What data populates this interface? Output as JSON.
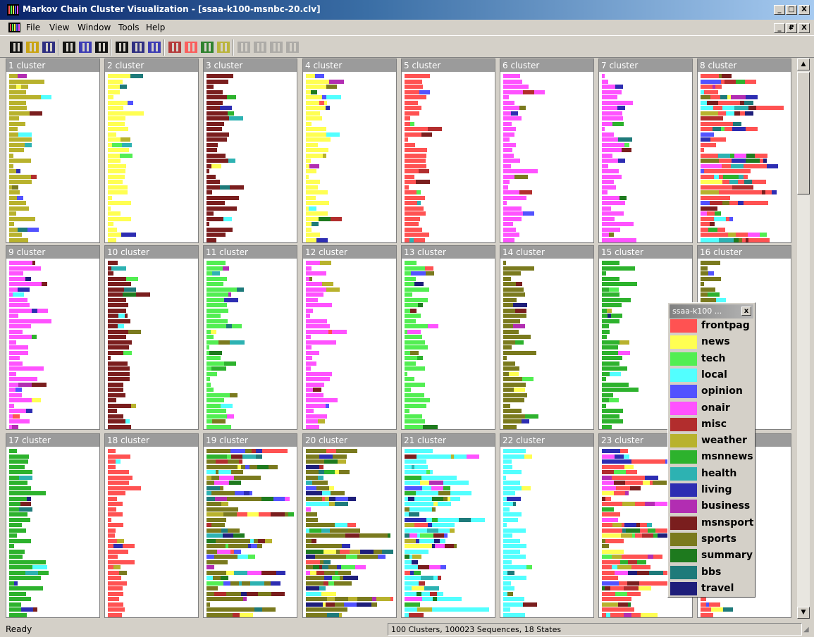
{
  "window": {
    "title": "Markov Chain Cluster Visualization - [ssaa-k100-msnbc-20.clv]"
  },
  "caption_buttons": [
    "_",
    "□",
    "X"
  ],
  "mdi_buttons": [
    "_",
    "₽",
    "X"
  ],
  "menu": [
    "File",
    "View",
    "Window",
    "Tools",
    "Help"
  ],
  "toolbar": [
    {
      "name": "new-file-icon"
    },
    {
      "name": "open-folder-icon"
    },
    {
      "name": "save-disk-icon"
    },
    {
      "sep": true
    },
    {
      "name": "layout-bars-icon"
    },
    {
      "name": "pattern-grid-icon"
    },
    {
      "name": "stacked-rows-icon"
    },
    {
      "sep": true
    },
    {
      "name": "columns-icon"
    },
    {
      "name": "grid-view-icon"
    },
    {
      "name": "sort-down-icon"
    },
    {
      "sep": true
    },
    {
      "name": "sort-numeric-icon"
    },
    {
      "name": "scatter-icon"
    },
    {
      "name": "tree-icon"
    },
    {
      "name": "expand-icon"
    },
    {
      "sep": true
    },
    {
      "name": "ab-icon"
    },
    {
      "name": "ab-comma-icon"
    },
    {
      "name": "star-burst-icon"
    },
    {
      "name": "star-burst-2-icon"
    }
  ],
  "legend": {
    "title": "ssaa-k100 ...",
    "close": "x",
    "items": [
      {
        "label": "frontpag",
        "color": "#ff5252"
      },
      {
        "label": "news",
        "color": "#ffff52"
      },
      {
        "label": "tech",
        "color": "#52ee52"
      },
      {
        "label": "local",
        "color": "#52ffff"
      },
      {
        "label": "opinion",
        "color": "#5252ff"
      },
      {
        "label": "onair",
        "color": "#ff52ff"
      },
      {
        "label": "misc",
        "color": "#b22d2d"
      },
      {
        "label": "weather",
        "color": "#b8b22d"
      },
      {
        "label": "msnnews",
        "color": "#2db22d"
      },
      {
        "label": "health",
        "color": "#2db2b2"
      },
      {
        "label": "living",
        "color": "#2d2db2"
      },
      {
        "label": "business",
        "color": "#b22db2"
      },
      {
        "label": "msnsport",
        "color": "#7a1e1e"
      },
      {
        "label": "sports",
        "color": "#7a7a1e"
      },
      {
        "label": "summary",
        "color": "#1e7a1e"
      },
      {
        "label": "bbs",
        "color": "#1e7a7a"
      },
      {
        "label": "travel",
        "color": "#1e1e7a"
      }
    ]
  },
  "clusters": [
    {
      "title": "1 cluster",
      "dominant": 7
    },
    {
      "title": "2 cluster",
      "dominant": 1
    },
    {
      "title": "3 cluster",
      "dominant": 12
    },
    {
      "title": "4 cluster",
      "dominant": 1
    },
    {
      "title": "5 cluster",
      "dominant": 0
    },
    {
      "title": "6 cluster",
      "dominant": 5
    },
    {
      "title": "7 cluster",
      "dominant": 5
    },
    {
      "title": "8 cluster",
      "dominant": 0
    },
    {
      "title": "9 cluster",
      "dominant": 5
    },
    {
      "title": "10 cluster",
      "dominant": 12
    },
    {
      "title": "11 cluster",
      "dominant": 2
    },
    {
      "title": "12 cluster",
      "dominant": 5
    },
    {
      "title": "13 cluster",
      "dominant": 2
    },
    {
      "title": "14 cluster",
      "dominant": 13
    },
    {
      "title": "15 cluster",
      "dominant": 8
    },
    {
      "title": "16 cluster",
      "dominant": 13
    },
    {
      "title": "17 cluster",
      "dominant": 8
    },
    {
      "title": "18 cluster",
      "dominant": 0
    },
    {
      "title": "19 cluster",
      "dominant": 13
    },
    {
      "title": "20 cluster",
      "dominant": 13
    },
    {
      "title": "21 cluster",
      "dominant": 3
    },
    {
      "title": "22 cluster",
      "dominant": 3
    },
    {
      "title": "23 cluster",
      "dominant": 0
    },
    {
      "title": "",
      "dominant": 0
    }
  ],
  "status": {
    "left": "Ready",
    "right": "100 Clusters, 100023 Sequences, 18 States"
  }
}
